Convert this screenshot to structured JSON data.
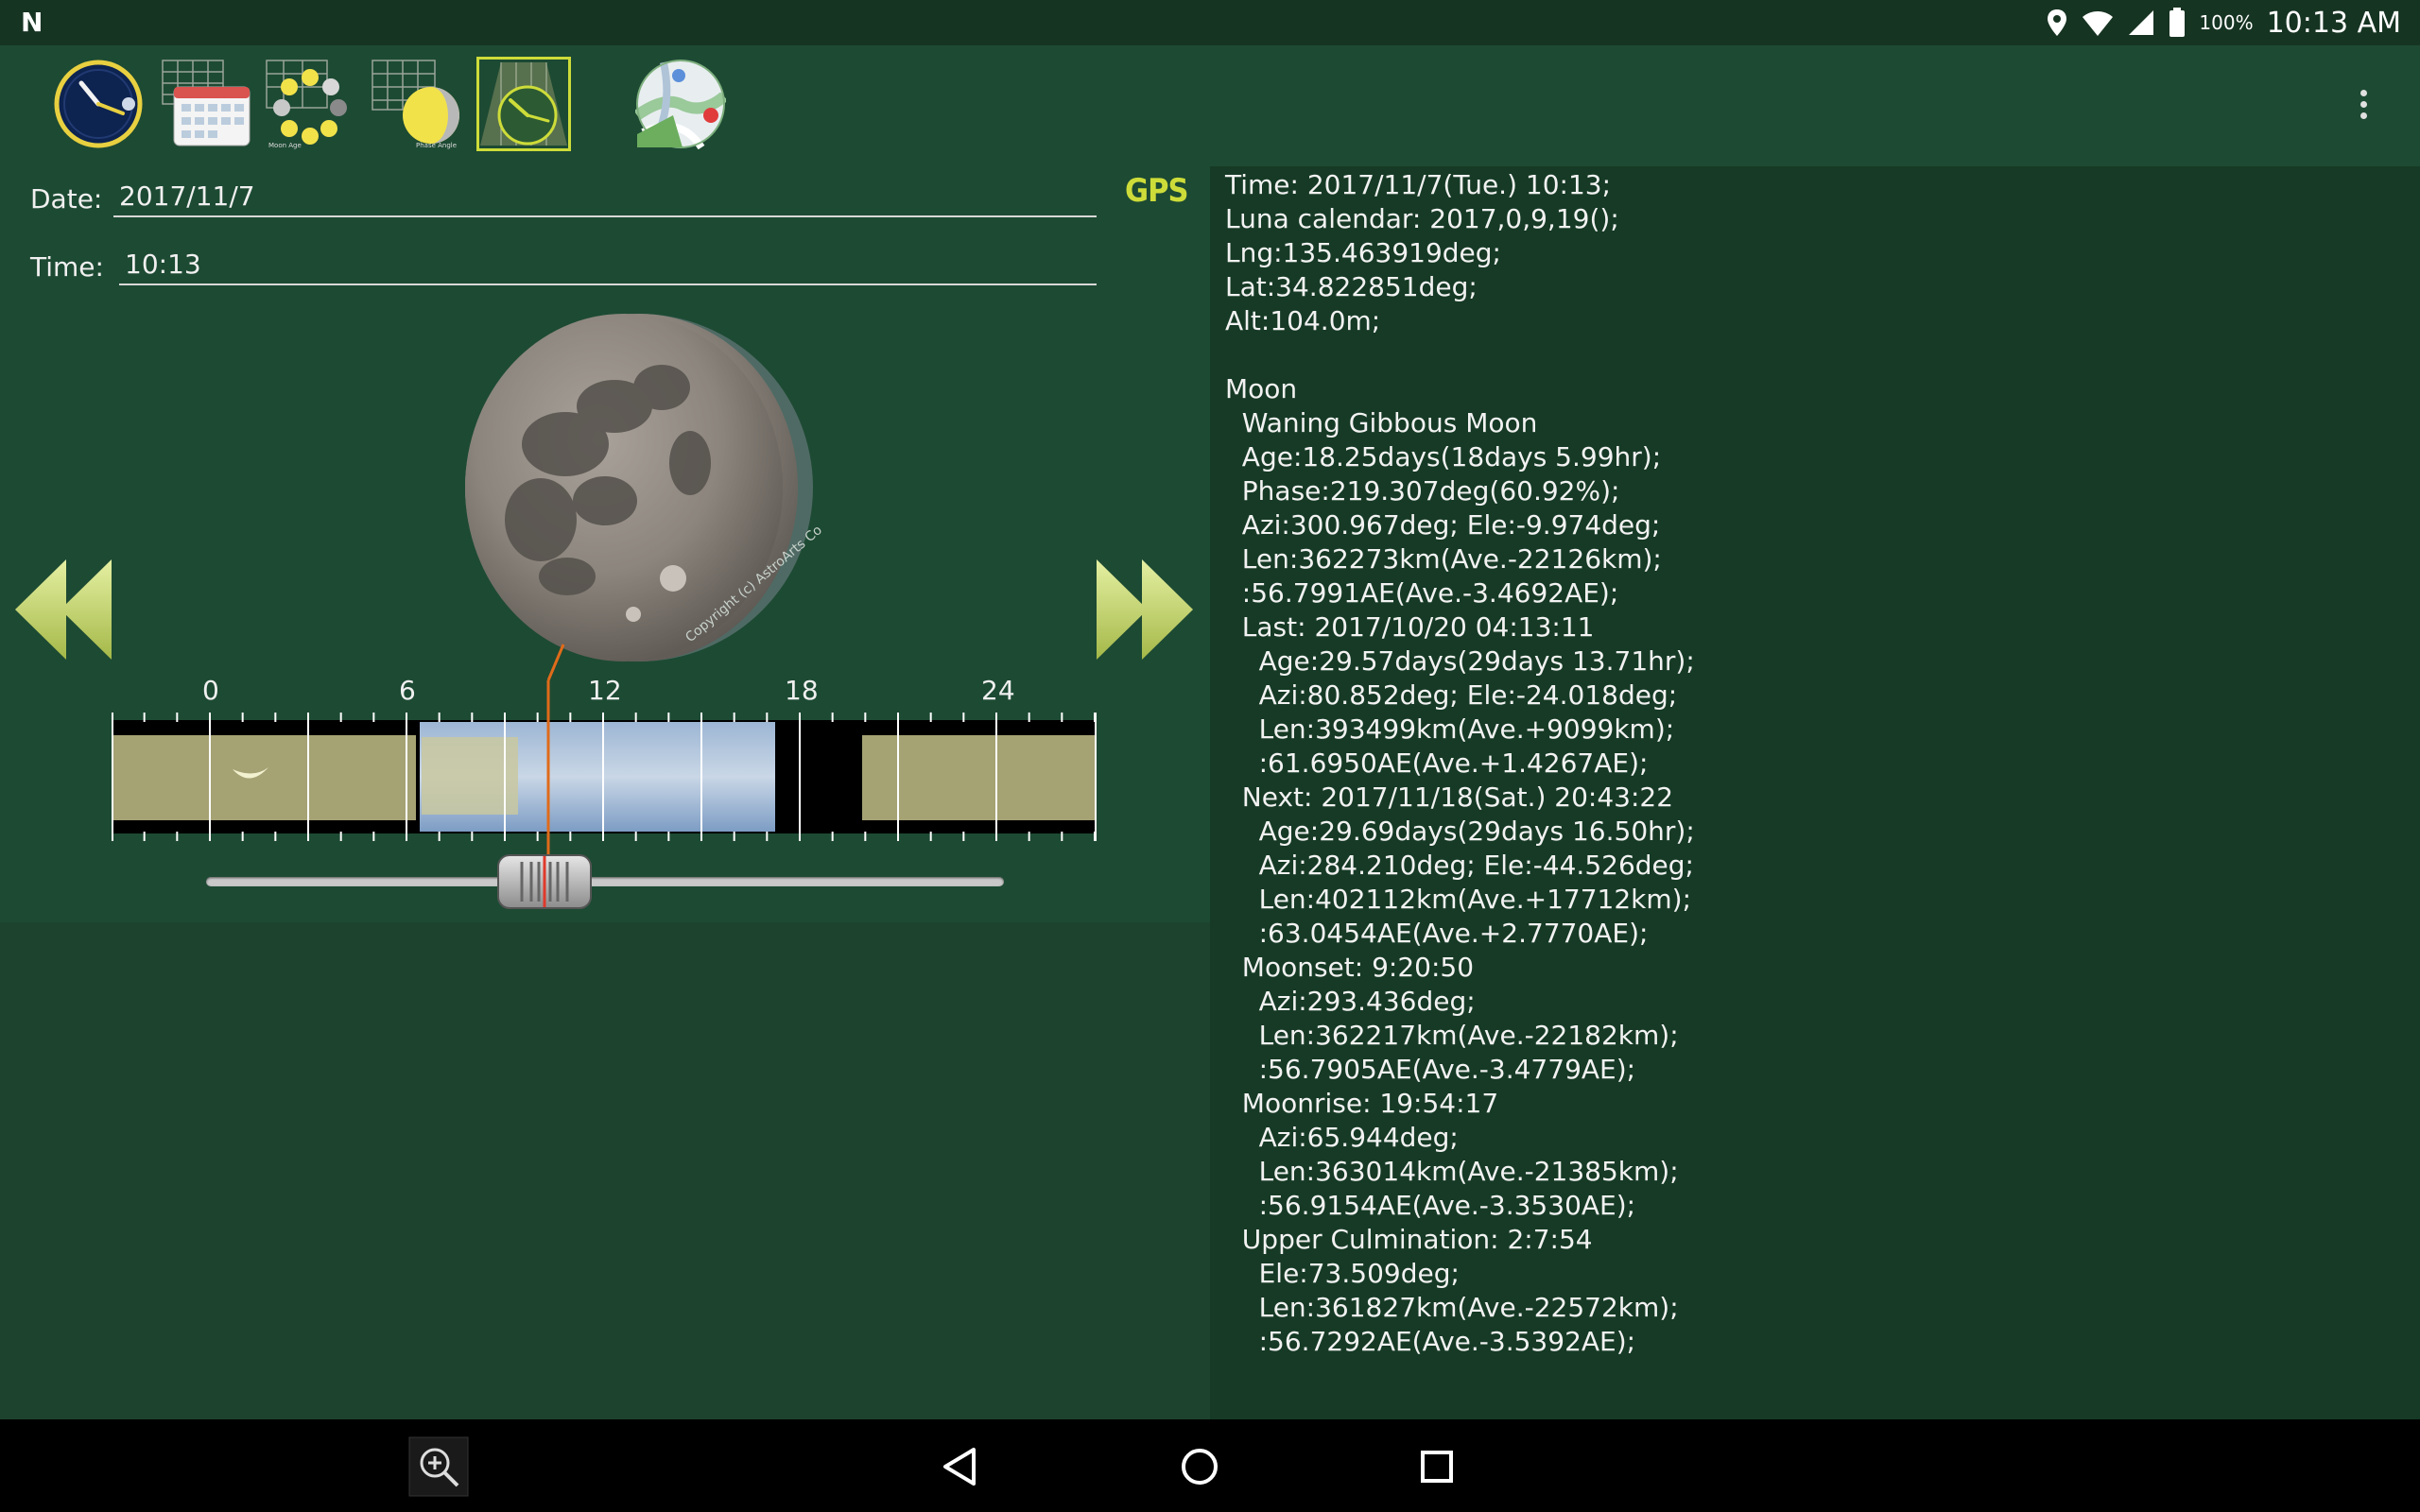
{
  "status_bar": {
    "battery_percent": "100%",
    "time": "10:13 AM"
  },
  "toolbar": {
    "tools": [
      {
        "name": "clock-tool-icon"
      },
      {
        "name": "calendar-tool-icon"
      },
      {
        "name": "moon-age-tool-icon",
        "caption": "Moon Age"
      },
      {
        "name": "phase-angle-tool-icon",
        "caption": "Phase Angle"
      },
      {
        "name": "time-chart-tool-icon",
        "selected": true
      },
      {
        "name": "map-tool-icon"
      }
    ]
  },
  "form": {
    "date_label": "Date:",
    "date_value": "2017/11/7",
    "time_label": "Time:",
    "time_value": "10:13",
    "gps_label": "GPS"
  },
  "moon_image": {
    "copyright": "Copyright (c) AstroArts Co."
  },
  "timeline": {
    "tick_labels": [
      "0",
      "6",
      "12",
      "18",
      "24"
    ],
    "current_hour": 10.22
  },
  "info": {
    "lines": [
      "Time: 2017/11/7(Tue.) 10:13;",
      "Luna calendar: 2017,0,9,19();",
      "Lng:135.463919deg;",
      "Lat:34.822851deg;",
      "Alt:104.0m;",
      "",
      "Moon",
      "  Waning Gibbous Moon",
      "  Age:18.25days(18days 5.99hr);",
      "  Phase:219.307deg(60.92%);",
      "  Azi:300.967deg; Ele:-9.974deg;",
      "  Len:362273km(Ave.-22126km);",
      "  :56.7991AE(Ave.-3.4692AE);",
      "  Last: 2017/10/20 04:13:11",
      "    Age:29.57days(29days 13.71hr);",
      "    Azi:80.852deg; Ele:-24.018deg;",
      "    Len:393499km(Ave.+9099km);",
      "    :61.6950AE(Ave.+1.4267AE);",
      "  Next: 2017/11/18(Sat.) 20:43:22",
      "    Age:29.69days(29days 16.50hr);",
      "    Azi:284.210deg; Ele:-44.526deg;",
      "    Len:402112km(Ave.+17712km);",
      "    :63.0454AE(Ave.+2.7770AE);",
      "  Moonset: 9:20:50",
      "    Azi:293.436deg;",
      "    Len:362217km(Ave.-22182km);",
      "    :56.7905AE(Ave.-3.4779AE);",
      "  Moonrise: 19:54:17",
      "    Azi:65.944deg;",
      "    Len:363014km(Ave.-21385km);",
      "    :56.9154AE(Ave.-3.3530AE);",
      "  Upper Culmination: 2:7:54",
      "    Ele:73.509deg;",
      "    Len:361827km(Ave.-22572km);",
      "    :56.7292AE(Ave.-3.5392AE);"
    ]
  },
  "colors": {
    "panel_bg": "#1d4a33",
    "accent": "#cddc39",
    "indicator": "#e06b1a"
  }
}
